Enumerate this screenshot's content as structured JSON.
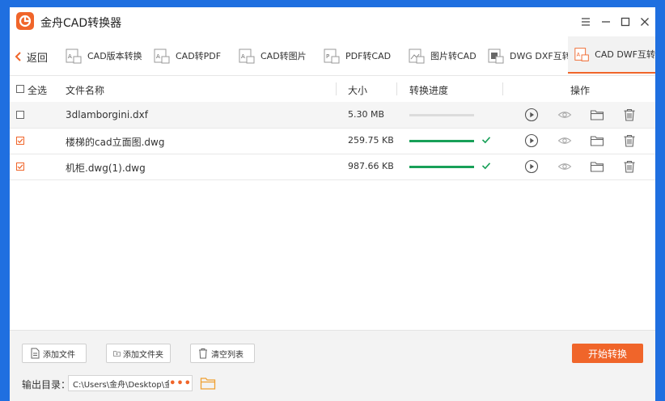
{
  "app": {
    "title": "金舟CAD转换器",
    "accent": "#f0652a",
    "progress_color": "#18a058"
  },
  "window_controls": [
    "menu-icon",
    "minimize-icon",
    "maximize-icon",
    "close-icon"
  ],
  "nav": {
    "back_label": "返回",
    "tabs": [
      {
        "label": "CAD版本转换",
        "active": false
      },
      {
        "label": "CAD转PDF",
        "active": false
      },
      {
        "label": "CAD转图片",
        "active": false
      },
      {
        "label": "PDF转CAD",
        "active": false
      },
      {
        "label": "图片转CAD",
        "active": false
      },
      {
        "label": "DWG DXF互转",
        "active": false
      },
      {
        "label": "CAD DWF互转",
        "active": true
      }
    ]
  },
  "table": {
    "headers": {
      "select_all": "全选",
      "name": "文件名称",
      "size": "大小",
      "progress": "转换进度",
      "actions": "操作"
    },
    "rows": [
      {
        "checked": false,
        "name": "3dlamborgini.dxf",
        "size": "5.30 MB",
        "progress": 0,
        "done": false
      },
      {
        "checked": true,
        "name": "楼梯的cad立面图.dwg",
        "size": "259.75 KB",
        "progress": 100,
        "done": true
      },
      {
        "checked": true,
        "name": "机柜.dwg(1).dwg",
        "size": "987.66 KB",
        "progress": 100,
        "done": true
      }
    ]
  },
  "footer": {
    "add_file": "添加文件",
    "add_folder": "添加文件夹",
    "clear_list": "清空列表",
    "start": "开始转换",
    "output_label": "输出目录：",
    "output_path": "C:\\Users\\金舟\\Desktop\\金舟",
    "more": "•••"
  }
}
